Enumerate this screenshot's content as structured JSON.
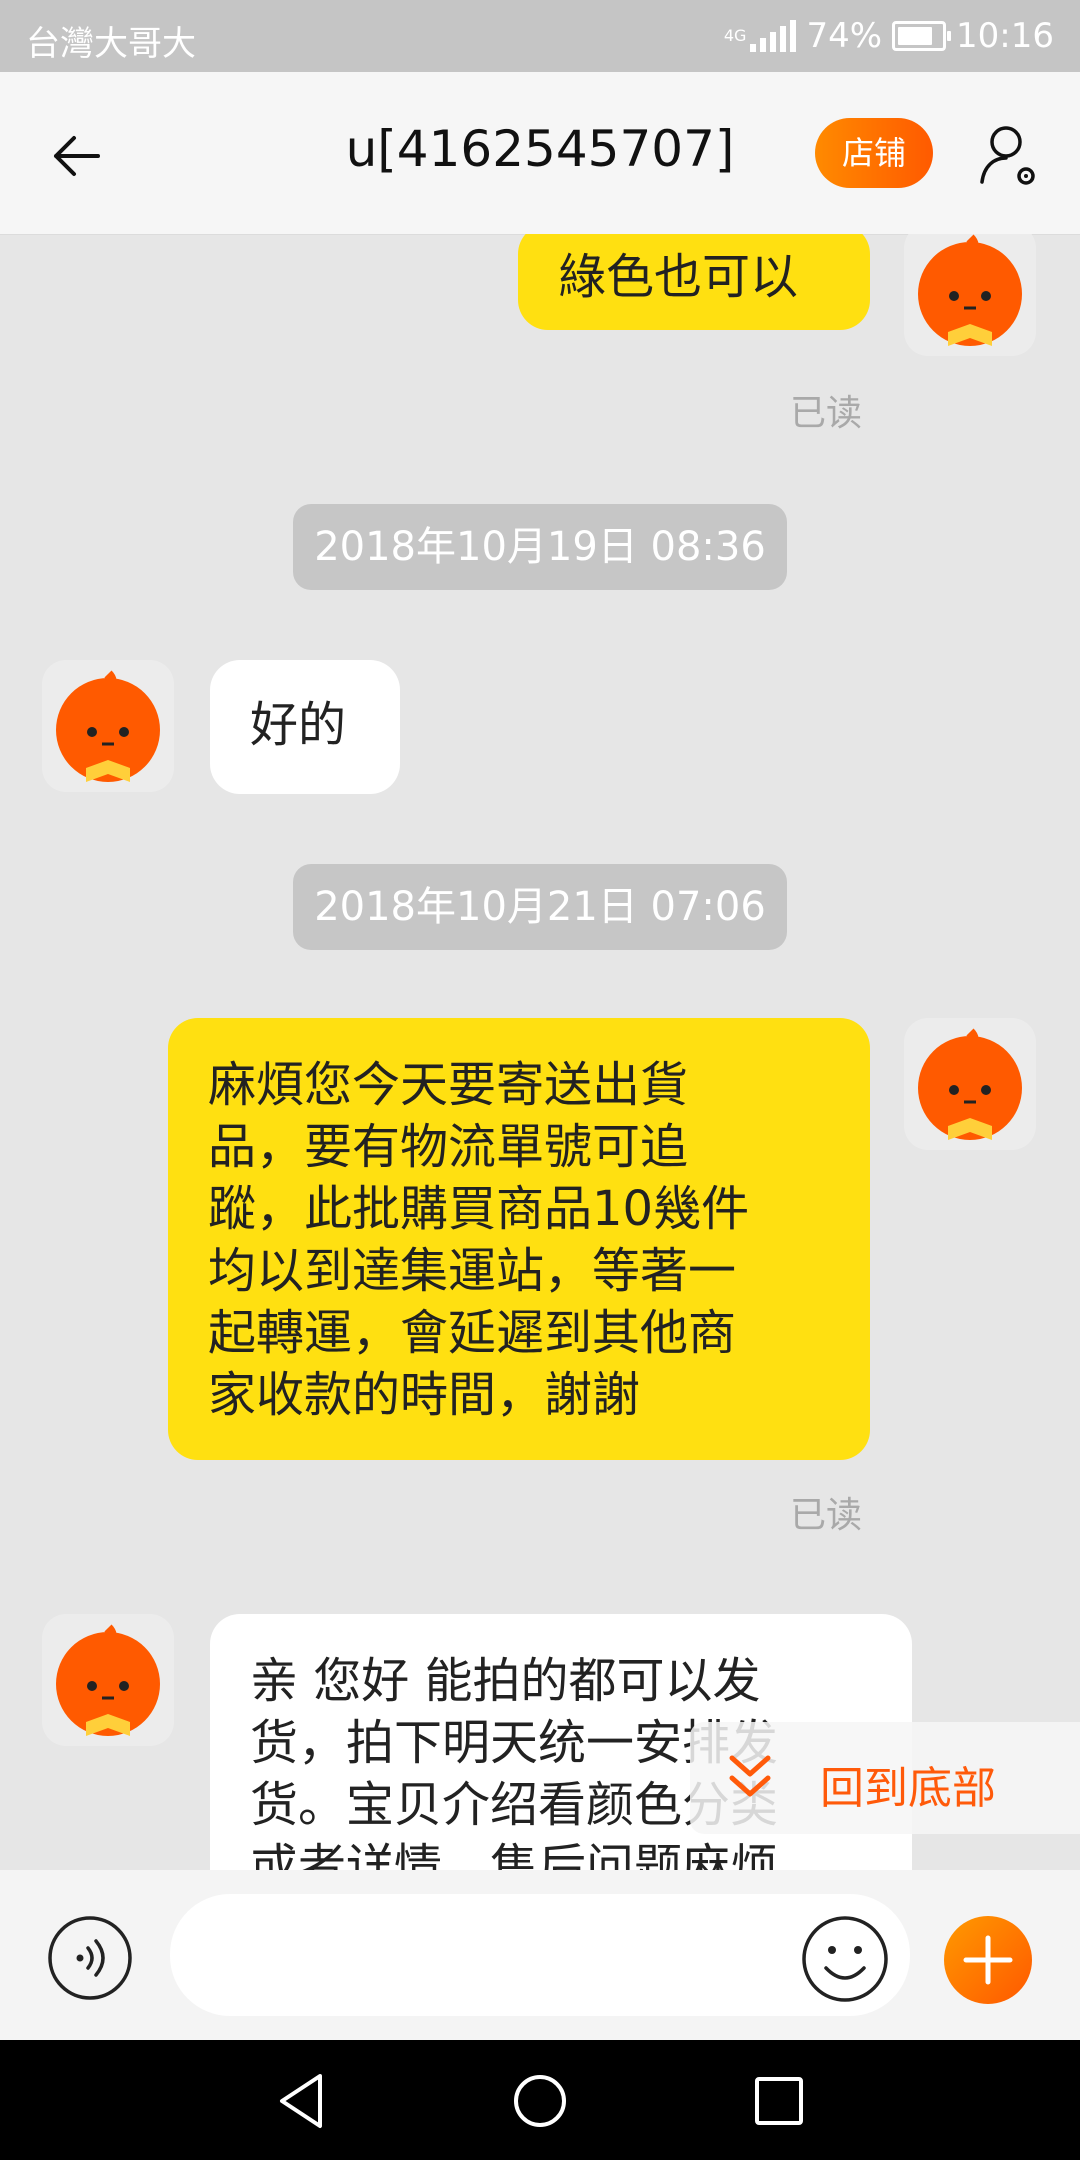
{
  "status_bar": {
    "carrier": "台灣大哥大",
    "network": "4G",
    "battery": "74%",
    "time": "10:16"
  },
  "header": {
    "title": "u[4162545707]",
    "shop_label": "店铺"
  },
  "messages": [
    {
      "side": "me",
      "text": "綠色也可以",
      "read": "已读"
    },
    {
      "timestamp": "2018年10月19日 08:36"
    },
    {
      "side": "them",
      "text": "好的"
    },
    {
      "timestamp": "2018年10月21日 07:06"
    },
    {
      "side": "me",
      "lines": [
        "麻煩您今天要寄送出貨",
        "品，要有物流單號可追",
        "蹤，此批購買商品10幾件",
        "均以到達集運站，等著一",
        "起轉運，會延遲到其他商",
        "家收款的時間，謝謝"
      ],
      "read": "已读"
    },
    {
      "side": "them",
      "lines": [
        "亲 您好 能拍的都可以发",
        "货，拍下明天统一安排发",
        "货。宝贝介绍看颜色分类",
        "或者详情，售后问题麻烦"
      ]
    }
  ],
  "back_to_bottom_label": "回到底部",
  "input": {
    "placeholder": "",
    "value": ""
  },
  "colors": {
    "accent": "#ff6a00",
    "my_bubble": "#ffe011",
    "background": "#e6e6e6"
  },
  "icons": [
    "back-arrow-icon",
    "user-settings-icon",
    "voice-icon",
    "emoji-icon",
    "plus-icon",
    "nav-back-icon",
    "nav-home-icon",
    "nav-recent-icon"
  ]
}
